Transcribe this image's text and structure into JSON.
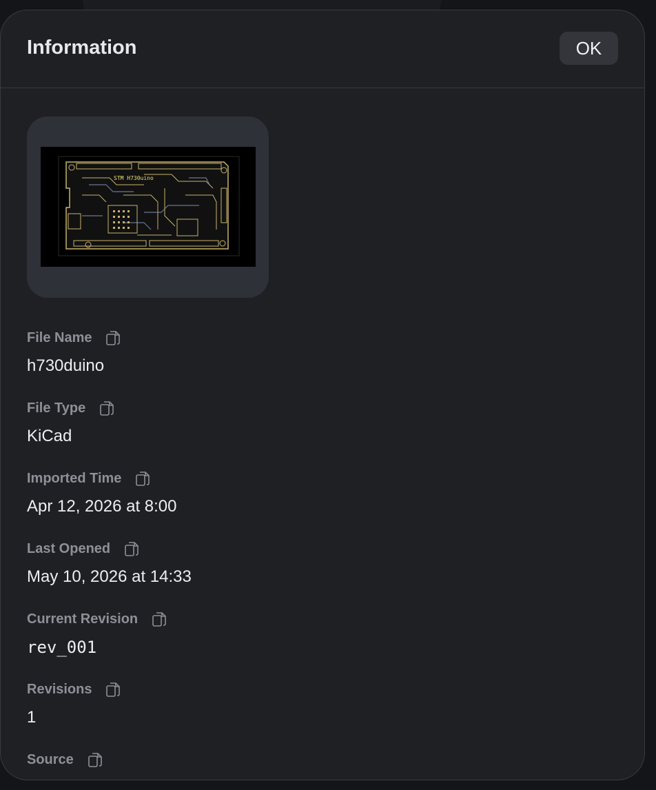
{
  "dialog": {
    "title": "Information",
    "ok_label": "OK"
  },
  "thumbnail": {
    "board_label": "STM H730uino"
  },
  "fields": [
    {
      "label": "File Name",
      "value": "h730duino"
    },
    {
      "label": "File Type",
      "value": "KiCad"
    },
    {
      "label": "Imported Time",
      "value": "Apr 12, 2026 at 8:00"
    },
    {
      "label": "Last Opened",
      "value": "May 10, 2026 at 14:33"
    },
    {
      "label": "Current Revision",
      "value": "rev_001"
    },
    {
      "label": "Revisions",
      "value": "1"
    },
    {
      "label": "Source",
      "value": ""
    }
  ],
  "colors": {
    "panel_bg": "#1f2024",
    "button_bg": "#34353a",
    "label_color": "#8e9097",
    "value_color": "#eceef1",
    "pcb_trace": "#c9b36a",
    "pcb_trace_alt": "#7f8fb5"
  }
}
